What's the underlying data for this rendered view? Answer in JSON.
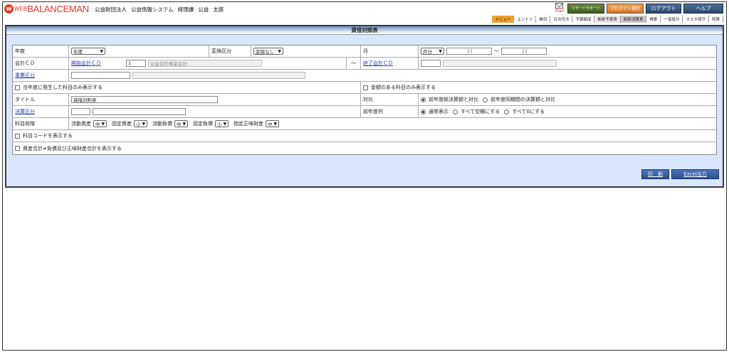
{
  "header": {
    "logo_mark": "W",
    "logo_prefix": "WEB",
    "logo_name": "BALANCEMAN",
    "org_items": [
      "公益財団法人",
      "公益情報システム",
      "経理課",
      "公益",
      "太郎"
    ],
    "mail_label": "Mail",
    "support_label": "リモートサポート",
    "product_label": "プロダクト選択",
    "logout_label": "ログアウト",
    "help_label": "ヘルプ"
  },
  "menu": [
    "メニュー",
    "エントリ",
    "帳目",
    "日次月次",
    "予算編成",
    "新新予算表",
    "新新決算表",
    "検索",
    "一括投分",
    "マスタ保守",
    "特殊"
  ],
  "title": "貸借対照表",
  "form": {
    "year_label": "年度",
    "year_value": "年度",
    "conv_label": "変換区分",
    "conv_value": "変換なし",
    "month_label": "月",
    "month_value": "月分",
    "date_from": "/ /",
    "date_tilde": "～",
    "date_to": "/ /",
    "account_label": "会計ＣＤ",
    "start_account_link": "開始会計ＣＤ",
    "start_account_code": "1",
    "start_account_name": "公益目的事業会計",
    "range_tilde": "～",
    "end_account_link": "終了会計ＣＤ",
    "business_link": "事業区分",
    "chk_current_year": "当年度に発生した科目のみ表示する",
    "chk_amount_only": "金額のある科目のみ表示する",
    "title_label": "タイトル",
    "title_value": "貸借対照表",
    "compare_label": "対比",
    "compare_opt1": "前年度総決算額と対比",
    "compare_opt2": "前年度同期間の決算額と対比",
    "settle_link": "決算区分",
    "prev_col_label": "前年度列",
    "prev_opt1": "通常表示",
    "prev_opt2": "すべて空欄にする",
    "prev_opt3": "すべて0にする",
    "level_label": "科目段階",
    "levels": [
      {
        "name": "流動資産",
        "value": "中"
      },
      {
        "name": "固定資産",
        "value": "小"
      },
      {
        "name": "流動負債",
        "value": "中"
      },
      {
        "name": "固定負債",
        "value": "小"
      },
      {
        "name": "指定正味財産",
        "value": "中"
      }
    ],
    "chk_show_code": "科目コードを表示する",
    "chk_show_total": "資産合計≠負債及び正味財産合計を表示する"
  },
  "buttons": {
    "print_label": "印　刷",
    "excel_label": "Excel出力"
  }
}
